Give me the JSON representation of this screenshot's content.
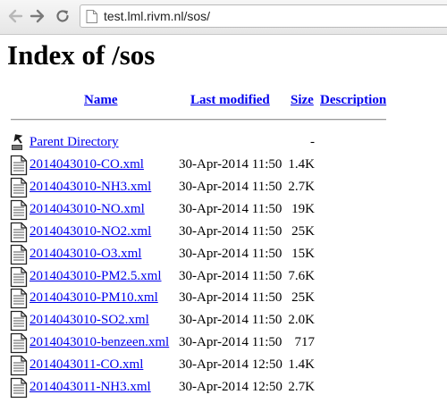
{
  "browser": {
    "url": "test.lml.rivm.nl/sos/"
  },
  "page": {
    "title": "Index of /sos",
    "columns": {
      "name": "Name",
      "last_modified": "Last modified",
      "size": "Size",
      "description": "Description"
    },
    "parent": {
      "label": "Parent Directory",
      "size": "-"
    },
    "files": [
      {
        "name": "2014043010-CO.xml",
        "modified": "30-Apr-2014 11:50",
        "size": "1.4K"
      },
      {
        "name": "2014043010-NH3.xml",
        "modified": "30-Apr-2014 11:50",
        "size": "2.7K"
      },
      {
        "name": "2014043010-NO.xml",
        "modified": "30-Apr-2014 11:50",
        "size": "19K"
      },
      {
        "name": "2014043010-NO2.xml",
        "modified": "30-Apr-2014 11:50",
        "size": "25K"
      },
      {
        "name": "2014043010-O3.xml",
        "modified": "30-Apr-2014 11:50",
        "size": "15K"
      },
      {
        "name": "2014043010-PM2.5.xml",
        "modified": "30-Apr-2014 11:50",
        "size": "7.6K"
      },
      {
        "name": "2014043010-PM10.xml",
        "modified": "30-Apr-2014 11:50",
        "size": "25K"
      },
      {
        "name": "2014043010-SO2.xml",
        "modified": "30-Apr-2014 11:50",
        "size": "2.0K"
      },
      {
        "name": "2014043010-benzeen.xml",
        "modified": "30-Apr-2014 11:50",
        "size": "717"
      },
      {
        "name": "2014043011-CO.xml",
        "modified": "30-Apr-2014 12:50",
        "size": "1.4K"
      },
      {
        "name": "2014043011-NH3.xml",
        "modified": "30-Apr-2014 12:50",
        "size": "2.7K"
      }
    ]
  },
  "icons": {
    "back": "back-arrow-icon",
    "forward": "forward-arrow-icon",
    "reload": "reload-icon",
    "page": "page-icon",
    "parent": "parent-directory-icon",
    "file": "text-file-icon"
  },
  "colors": {
    "link": "#0000ee",
    "text": "#000000"
  }
}
